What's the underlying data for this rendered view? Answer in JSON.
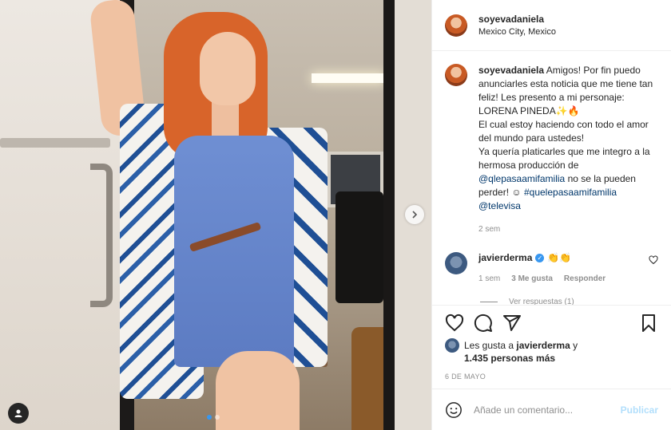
{
  "post": {
    "username": "soyevadaniela",
    "location": "Mexico City, Mexico",
    "caption": {
      "username": "soyevadaniela",
      "text_1": "Amigos! Por fin puedo anunciarles esta noticia que me tiene tan feliz! Les presento a mi personaje: LORENA PINEDA",
      "emoji_1": "✨🔥",
      "text_2": "El cual estoy haciendo con todo el amor del mundo para ustedes!",
      "text_3": "Ya quería platicarles que me integro a la hermosa producción de",
      "mention_1": "@qlepasaamifamilia",
      "text_4": "no se la pueden perder!",
      "emoji_2": "☺",
      "hashtag_1": "#quelepasaamifamilia",
      "mention_2": "@televisa",
      "time": "2 sem"
    },
    "comment": {
      "username": "javierderma",
      "emoji": "👏👏",
      "time": "1 sem",
      "likes": "3 Me gusta",
      "reply": "Responder",
      "view_replies": "Ver respuestas (1)"
    },
    "likes": {
      "prefix": "Les gusta a",
      "user": "javierderma",
      "mid": "y",
      "count": "1.435 personas más"
    },
    "date": "6 DE MAYO",
    "add_comment": {
      "placeholder": "Añade un comentario...",
      "publish": "Publicar"
    },
    "carousel": {
      "total": 2,
      "active_index": 0
    },
    "colors": {
      "accent": "#3897f0",
      "link": "#00376b",
      "muted": "#8e8e8e",
      "publish_disabled": "#b2dffc"
    },
    "icons": {
      "like": "heart-icon",
      "comment": "comment-icon",
      "share": "share-icon",
      "save": "bookmark-icon",
      "next": "chevron-right-icon",
      "tags": "user-tag-icon",
      "emoji": "emoji-icon"
    }
  }
}
